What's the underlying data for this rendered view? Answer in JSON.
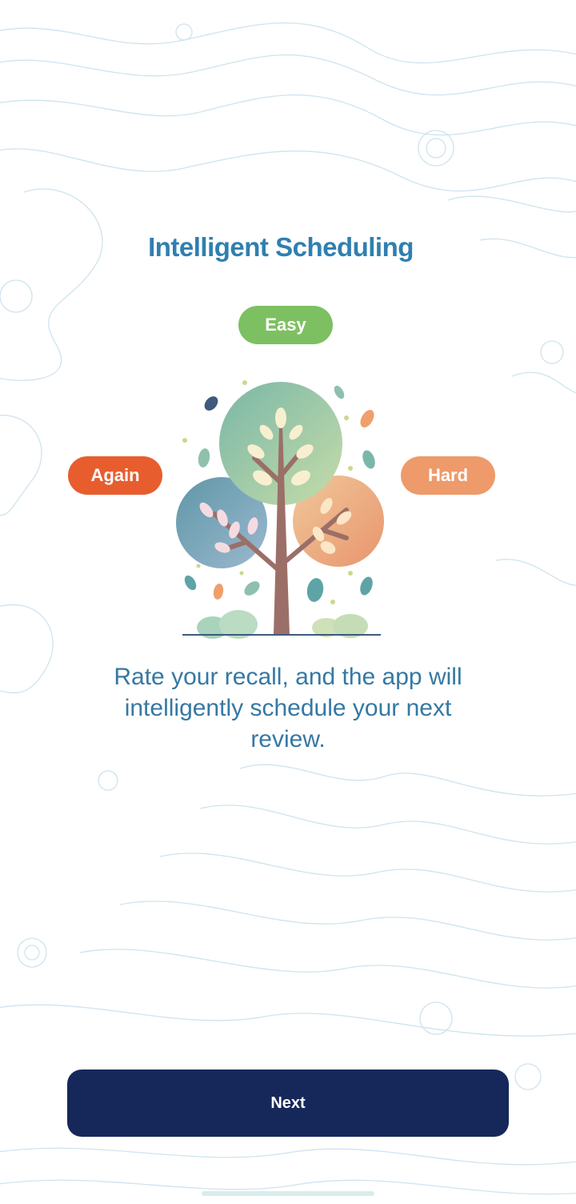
{
  "colors": {
    "title": "#2f7fb1",
    "description": "#3578a3",
    "easy": "#7dc062",
    "again": "#e85d2e",
    "hard": "#ee9a6a",
    "next_button": "#16285a",
    "contour": "#cfe3ee"
  },
  "header": {
    "title": "Intelligent Scheduling"
  },
  "ratings": {
    "easy_label": "Easy",
    "again_label": "Again",
    "hard_label": "Hard"
  },
  "illustration": {
    "icon": "tree-illustration"
  },
  "description": "Rate your recall, and the app will intelligently schedule your next review.",
  "footer": {
    "next_label": "Next"
  }
}
